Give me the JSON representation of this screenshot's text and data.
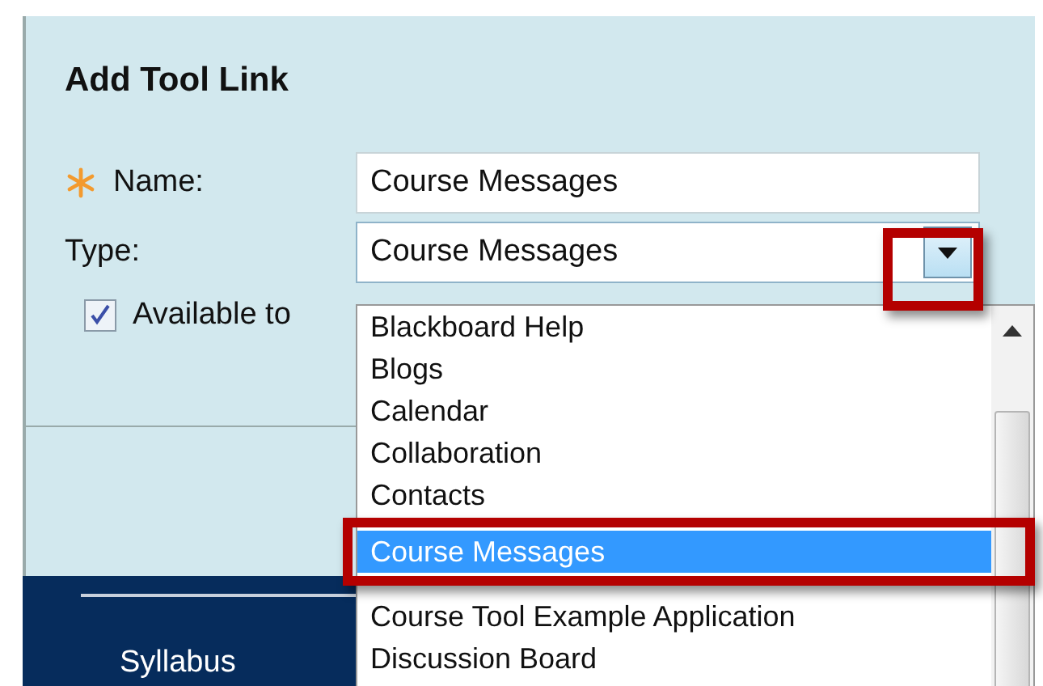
{
  "panel": {
    "title": "Add Tool Link"
  },
  "fields": [
    {
      "kind": "text",
      "label": "Name:",
      "required": true,
      "value": "Course Messages"
    },
    {
      "kind": "select",
      "label": "Type:",
      "required": false,
      "value": "Course Messages"
    }
  ],
  "checkbox": {
    "label": "Available to",
    "checked": true
  },
  "dropdown": {
    "items": [
      {
        "label": "Blackboard Help",
        "selected": false
      },
      {
        "label": "Blogs",
        "selected": false
      },
      {
        "label": "Calendar",
        "selected": false
      },
      {
        "label": "Collaboration",
        "selected": false
      },
      {
        "label": "Contacts",
        "selected": false
      },
      {
        "label": "Course Messages",
        "selected": true
      },
      {
        "label": "Course Tool Example Application",
        "selected": false
      },
      {
        "label": "Discussion Board",
        "selected": false
      }
    ]
  },
  "nav": {
    "items": [
      {
        "label": "Syllabus"
      }
    ]
  }
}
